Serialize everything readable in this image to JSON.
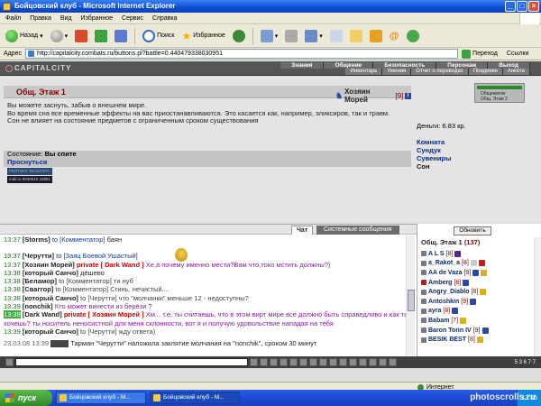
{
  "window": {
    "title": "Бойцовский клуб - Microsoft Internet Explorer"
  },
  "menu": [
    "Файл",
    "Правка",
    "Вид",
    "Избранное",
    "Сервис",
    "Справка"
  ],
  "toolbar": {
    "back": "Назад",
    "search": "Поиск",
    "favorites": "Избранное"
  },
  "address": {
    "label": "Адрес",
    "url": "http://capitalcity.combats.ru/buttons.pl?battle=0.440479338030951",
    "go": "Переход",
    "links": "Ссылки"
  },
  "nav": {
    "logo": "CAPITALCITY",
    "row1": [
      "Знания",
      "Общение",
      "Безопасность",
      "Персонаж",
      "Выход"
    ],
    "row2": [
      "Инвентарь",
      "Умения",
      "Отчет о переводах",
      "Поединки",
      "Анкета"
    ]
  },
  "location": {
    "title": "Общ. Этаж 1",
    "owner_name": "Хозяин Морей",
    "owner_level": "[9]",
    "sleep_text": [
      "Вы можете заснуть, забыв о внешнем мире.",
      "Во время сна все временные эффекты на вас приостанавливаются. Это касается как, например, эликсиров, так и травм.",
      "Сон не влияет на состояние предметов с ограниченным сроком существования"
    ],
    "state_label": "Состояние:",
    "state_value": "Вы спите",
    "wake_link": "Проснуться",
    "money_label": "Деньги:",
    "money_value": "6.83 кр.",
    "places": [
      "Комната",
      "Сундук",
      "Сувениры",
      "Сон"
    ],
    "minimap": [
      "Общежитие",
      "Общ. Этаж 2"
    ],
    "counters": [
      "РЕЙТИНГ 992167970",
      "mail.ru 9836810 33881"
    ]
  },
  "chat": {
    "tabs": [
      "Чат",
      "Системные сообщения"
    ],
    "lines": [
      {
        "time": "13:37",
        "nick": "[Storms]",
        "to": "to [Комментатор]",
        "text": "баян"
      },
      {
        "time": "13:37",
        "nick": "[Черутти]",
        "to": "to [Заяц Боевой Ушастый]",
        "text": ""
      },
      {
        "time": "13:37",
        "nick": "[Хозяин Морей]",
        "private": "private [ Dark Wand ]",
        "ptext": "Хе,а почему именно мести?Вам что,токо мстить должны?)"
      },
      {
        "time": "13:38",
        "nick": "[который Санчо]",
        "to": "",
        "text": "дёшево"
      },
      {
        "time": "13:38",
        "nick": "[Беламор]",
        "to": "to [Комментатор]",
        "text": "ти нуб"
      },
      {
        "time": "13:38",
        "nick": "[Сваггор]",
        "to": "to [Комментатор]",
        "text": "Сгинь, нечистый...."
      },
      {
        "time": "13:38",
        "nick": "[который Санчо]",
        "to": "to [Черутти]",
        "text": "что \"молчанки\" меньше 12 - недоступны?"
      },
      {
        "time": "13:39",
        "nick": "[nonchik]",
        "to": "",
        "text": "Кто может винести из берёзи ?"
      },
      {
        "time": "13:39",
        "nick": "[Dark Wand]",
        "private": "private [ Хозяин Морей ]",
        "ptext": "Хм... т.е. ты считаешь, что в этом вирт мире все должно быть справедливо и как ты хочешь? ты носитель неносистной для меня склонности, вот я и получую удовольствие нападая на тебя",
        "highlight": true
      },
      {
        "time": "13:39",
        "nick": "[который Санчо]",
        "to": "to [Черутти]",
        "text": "жду ответа)"
      }
    ],
    "system": {
      "time": "23.03.08 13:39",
      "text": "Тарман \"Черутти\" наложила заклятие молчания на \"nonchik\", сроком 30 минут"
    }
  },
  "online": {
    "refresh": "Обновить",
    "title": "Общ. Этаж 1",
    "count": "(137)",
    "players": [
      {
        "nick": "A L S",
        "level": "[8]"
      },
      {
        "nick": "a_Rakot_a",
        "level": "[8]"
      },
      {
        "nick": "AA de Vaza",
        "level": "[9]"
      },
      {
        "nick": "Amberg",
        "level": "[8]"
      },
      {
        "nick": "Angry_Diablo",
        "level": "[8]"
      },
      {
        "nick": "Antoshkin",
        "level": "[9]"
      },
      {
        "nick": "ayra",
        "level": "[8]"
      },
      {
        "nick": "Babam",
        "level": "[7]"
      },
      {
        "nick": "Baron Torin IV",
        "level": "[9]"
      },
      {
        "nick": "BESIK BEST",
        "level": "[8]"
      }
    ]
  },
  "input": {
    "digits": "5 3 6 7 7"
  },
  "statusbar": {
    "text": "",
    "zone": "Интернет"
  },
  "taskbar": {
    "start": "пуск",
    "tasks": [
      "Бойцовский клуб - M...",
      "Бойцовский клуб - M..."
    ],
    "clock": "13:45"
  },
  "watermark": "photoscrolls.ru"
}
